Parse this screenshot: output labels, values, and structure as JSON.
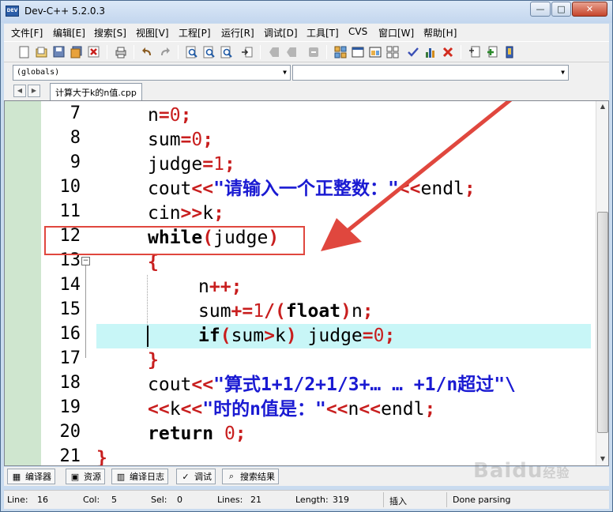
{
  "window": {
    "title": "Dev-C++ 5.2.0.3",
    "icon": "devcpp-app-icon",
    "icon_text": "DEV"
  },
  "window_buttons": {
    "minimize": "—",
    "maximize": "□",
    "close": "✕"
  },
  "menu": [
    "文件[F]",
    "编辑[E]",
    "搜索[S]",
    "视图[V]",
    "工程[P]",
    "运行[R]",
    "调试[D]",
    "工具[T]",
    "CVS",
    "窗口[W]",
    "帮助[H]"
  ],
  "toolbar": {
    "icons": [
      "new-file-icon",
      "open-icon",
      "save-icon",
      "save-all-icon",
      "close-file-icon",
      "print-icon",
      "undo-icon",
      "redo-icon",
      "find-icon",
      "replace-icon",
      "find-next-icon",
      "goto-line-icon",
      "bookmark-icon",
      "bookmark-next-icon",
      "stop-icon",
      "compile-icon",
      "run-icon",
      "compile-run-icon",
      "rebuild-icon",
      "syntax-check-icon",
      "chart-icon",
      "delete-icon",
      "new-project-icon",
      "add-file-icon",
      "project-options-icon"
    ],
    "accent": "#1f5aa6"
  },
  "combos": {
    "scope": "(globals)",
    "member": ""
  },
  "tabs": {
    "file": "计算大于k的n值.cpp"
  },
  "editor": {
    "line_numbers": [
      "7",
      "8",
      "9",
      "10",
      "11",
      "12",
      "13",
      "14",
      "15",
      "16",
      "17",
      "18",
      "19",
      "20",
      "21"
    ],
    "lines": {
      "l7": [
        "n",
        "=",
        "0",
        ";"
      ],
      "l8": [
        "sum",
        "=",
        "0",
        ";"
      ],
      "l9": [
        "judge",
        "=",
        "1",
        ";"
      ],
      "l10": [
        "cout",
        "<<",
        "\"请输入一个正整数：\"",
        "<<",
        "endl",
        ";"
      ],
      "l11": [
        "cin",
        ">>",
        "k",
        ";"
      ],
      "l12": [
        "while",
        "(",
        "judge",
        ")"
      ],
      "l13": [
        "{"
      ],
      "l14": [
        "n",
        "++",
        ";"
      ],
      "l15": [
        "sum",
        "+=",
        "1",
        "/",
        "(",
        "float",
        ")",
        "n",
        ";"
      ],
      "l16": [
        "if",
        "(",
        "sum",
        ">",
        "k",
        ")",
        " judge",
        "=",
        "0",
        ";"
      ],
      "l17": [
        "}"
      ],
      "l18": [
        "cout",
        "<<",
        "\"算式1+1/2+1/3+… … +1/n超过\"\\"
      ],
      "l19": [
        "<<",
        "k",
        "<<",
        "\"时的n值是：\"",
        "<<",
        "n",
        "<<",
        "endl",
        ";"
      ],
      "l20": [
        "return",
        " 0",
        ";"
      ],
      "l21": [
        "}"
      ]
    },
    "current_line_color": "#c8f6f7",
    "annotation_color": "#e0473e"
  },
  "bottom_tabs": [
    {
      "label": "编译器",
      "icon": "compiler-icon"
    },
    {
      "label": "资源",
      "icon": "resources-icon"
    },
    {
      "label": "编译日志",
      "icon": "compile-log-icon"
    },
    {
      "label": "调试",
      "icon": "debug-icon"
    },
    {
      "label": "搜索结果",
      "icon": "search-results-icon"
    }
  ],
  "status": {
    "line_label": "Line:",
    "line": "16",
    "col_label": "Col:",
    "col": "5",
    "sel_label": "Sel:",
    "sel": "0",
    "lines_label": "Lines:",
    "lines": "21",
    "length_label": "Length:",
    "length": "319",
    "mode": "插入",
    "message": "Done parsing"
  },
  "watermark": {
    "text": "Baidu",
    "sub": "经验"
  }
}
